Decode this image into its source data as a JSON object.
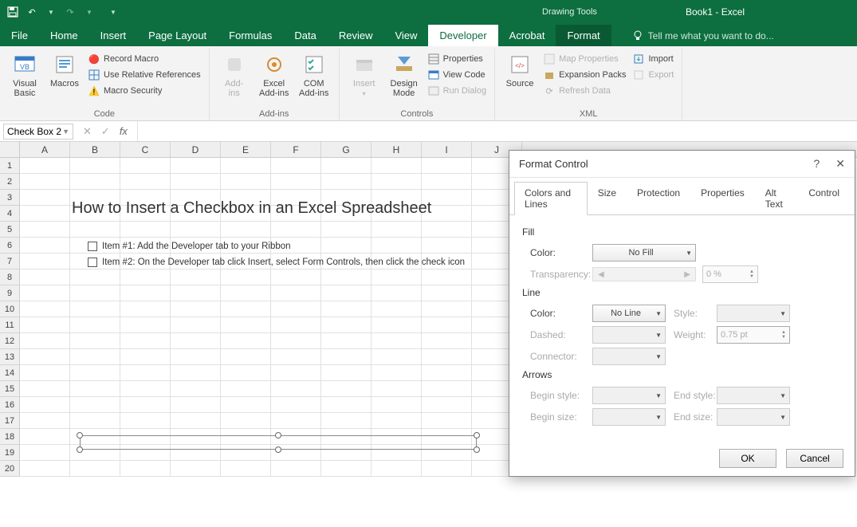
{
  "app": {
    "drawing_tools": "Drawing Tools",
    "doc_title": "Book1 - Excel"
  },
  "menu": {
    "file": "File",
    "home": "Home",
    "insert": "Insert",
    "page_layout": "Page Layout",
    "formulas": "Formulas",
    "data": "Data",
    "review": "Review",
    "view": "View",
    "developer": "Developer",
    "acrobat": "Acrobat",
    "format": "Format",
    "tellme": "Tell me what you want to do..."
  },
  "ribbon": {
    "code": {
      "visual_basic": "Visual\nBasic",
      "macros": "Macros",
      "record_macro": "Record Macro",
      "use_rel": "Use Relative References",
      "macro_sec": "Macro Security",
      "label": "Code"
    },
    "addins": {
      "addins": "Add-\nins",
      "excel": "Excel\nAdd-ins",
      "com": "COM\nAdd-ins",
      "label": "Add-ins"
    },
    "controls": {
      "insert": "Insert",
      "design": "Design\nMode",
      "properties": "Properties",
      "view_code": "View Code",
      "run_dialog": "Run Dialog",
      "label": "Controls"
    },
    "xml": {
      "source": "Source",
      "map_props": "Map Properties",
      "expansion": "Expansion Packs",
      "refresh": "Refresh Data",
      "import": "Import",
      "export": "Export",
      "label": "XML"
    }
  },
  "formula": {
    "name_box": "Check Box 2"
  },
  "sheet": {
    "cols": [
      "A",
      "B",
      "C",
      "D",
      "E",
      "F",
      "G",
      "H",
      "I",
      "J"
    ],
    "rows": [
      "1",
      "2",
      "3",
      "4",
      "5",
      "6",
      "7",
      "8",
      "9",
      "10",
      "11",
      "12",
      "13",
      "14",
      "15",
      "16",
      "17",
      "18",
      "19",
      "20"
    ],
    "title": "How to Insert a Checkbox in an Excel Spreadsheet",
    "item1": "Item #1: Add the Developer tab to your Ribbon",
    "item2": "Item #2: On the Developer tab click Insert, select Form Controls, then click the check icon"
  },
  "dialog": {
    "title": "Format Control",
    "tabs": {
      "colors": "Colors and Lines",
      "size": "Size",
      "protection": "Protection",
      "properties": "Properties",
      "alt": "Alt Text",
      "control": "Control"
    },
    "fill": {
      "h": "Fill",
      "color_l": "Color:",
      "color_v": "No Fill",
      "trans_l": "Transparency:",
      "trans_v": "0 %"
    },
    "line": {
      "h": "Line",
      "color_l": "Color:",
      "color_v": "No Line",
      "dashed_l": "Dashed:",
      "style_l": "Style:",
      "weight_l": "Weight:",
      "weight_v": "0.75 pt",
      "connector_l": "Connector:"
    },
    "arrows": {
      "h": "Arrows",
      "bstyle": "Begin style:",
      "bsize": "Begin size:",
      "estyle": "End style:",
      "esize": "End size:"
    },
    "ok": "OK",
    "cancel": "Cancel"
  }
}
